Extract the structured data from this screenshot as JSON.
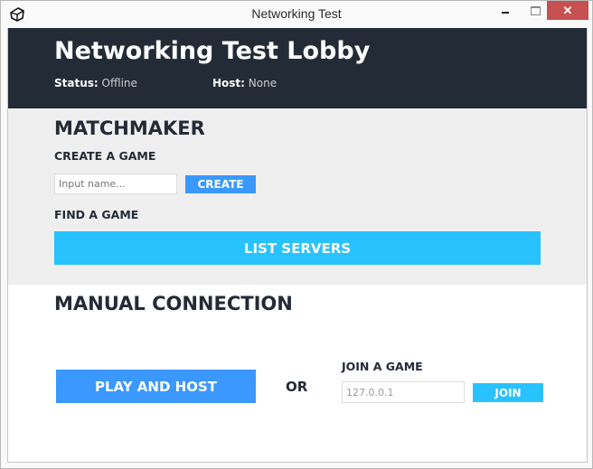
{
  "window": {
    "title": "Networking Test",
    "close_glyph": "✕"
  },
  "header": {
    "title": "Networking Test Lobby",
    "status_label": "Status:",
    "status_value": "Offline",
    "host_label": "Host:",
    "host_value": "None"
  },
  "matchmaker": {
    "title": "MATCHMAKER",
    "create_heading": "CREATE A GAME",
    "name_input_placeholder": "Input name...",
    "name_input_value": "",
    "create_button": "CREATE",
    "find_heading": "FIND A GAME",
    "list_servers_button": "LIST SERVERS"
  },
  "manual": {
    "title": "MANUAL CONNECTION",
    "play_host_button": "PLAY AND HOST",
    "or_label": "OR",
    "join_heading": "JOIN A GAME",
    "address_input_value": "127.0.0.1",
    "join_button": "JOIN"
  },
  "colors": {
    "header_bg": "#232b36",
    "matchmaker_bg": "#efefef",
    "primary_blue": "#3a98ff",
    "cyan": "#27c2ff",
    "close_red": "#c75050"
  }
}
